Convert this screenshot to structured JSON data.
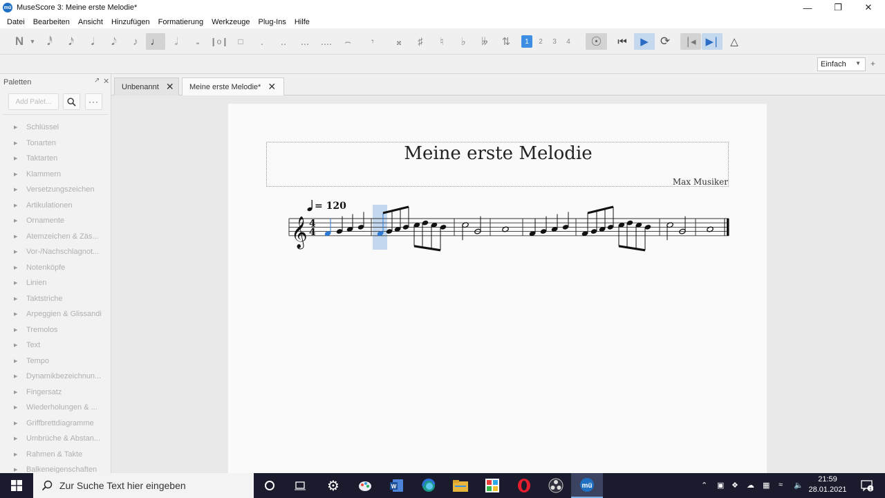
{
  "window": {
    "title": "MuseScore 3: Meine erste Melodie*",
    "logo_text": "mü"
  },
  "menu": [
    "Datei",
    "Bearbeiten",
    "Ansicht",
    "Hinzufügen",
    "Formatierung",
    "Werkzeuge",
    "Plug-Ins",
    "Hilfe"
  ],
  "toolbar": {
    "voices": [
      "1",
      "2",
      "3",
      "4"
    ]
  },
  "workspace": {
    "selected": "Einfach",
    "add_label": "+"
  },
  "palette": {
    "header": "Paletten",
    "add_placeholder": "Add Palet...",
    "items": [
      "Schlüssel",
      "Tonarten",
      "Taktarten",
      "Klammern",
      "Versetzungszeichen",
      "Artikulationen",
      "Ornamente",
      "Atemzeichen & Zäs...",
      "Vor-/Nachschlagnot...",
      "Notenköpfe",
      "Linien",
      "Taktstriche",
      "Arpeggien & Glissandi",
      "Tremolos",
      "Text",
      "Tempo",
      "Dynamikbezeichnun...",
      "Fingersatz",
      "Wiederholungen & ...",
      "Griffbrettdiagramme",
      "Umbrüche & Abstan...",
      "Rahmen & Takte",
      "Balkeneigenschaften"
    ]
  },
  "tabs": [
    {
      "label": "Unbenannt",
      "active": false
    },
    {
      "label": "Meine erste Melodie*",
      "active": true
    }
  ],
  "score": {
    "title": "Meine erste Melodie",
    "composer": "Max Musiker",
    "tempo": "= 120",
    "time_signature": "4/4",
    "accent_color": "#2b7bd6"
  },
  "taskbar": {
    "search_placeholder": "Zur Suche Text hier eingeben",
    "time": "21:59",
    "date": "28.01.2021",
    "notification_count": "1"
  }
}
